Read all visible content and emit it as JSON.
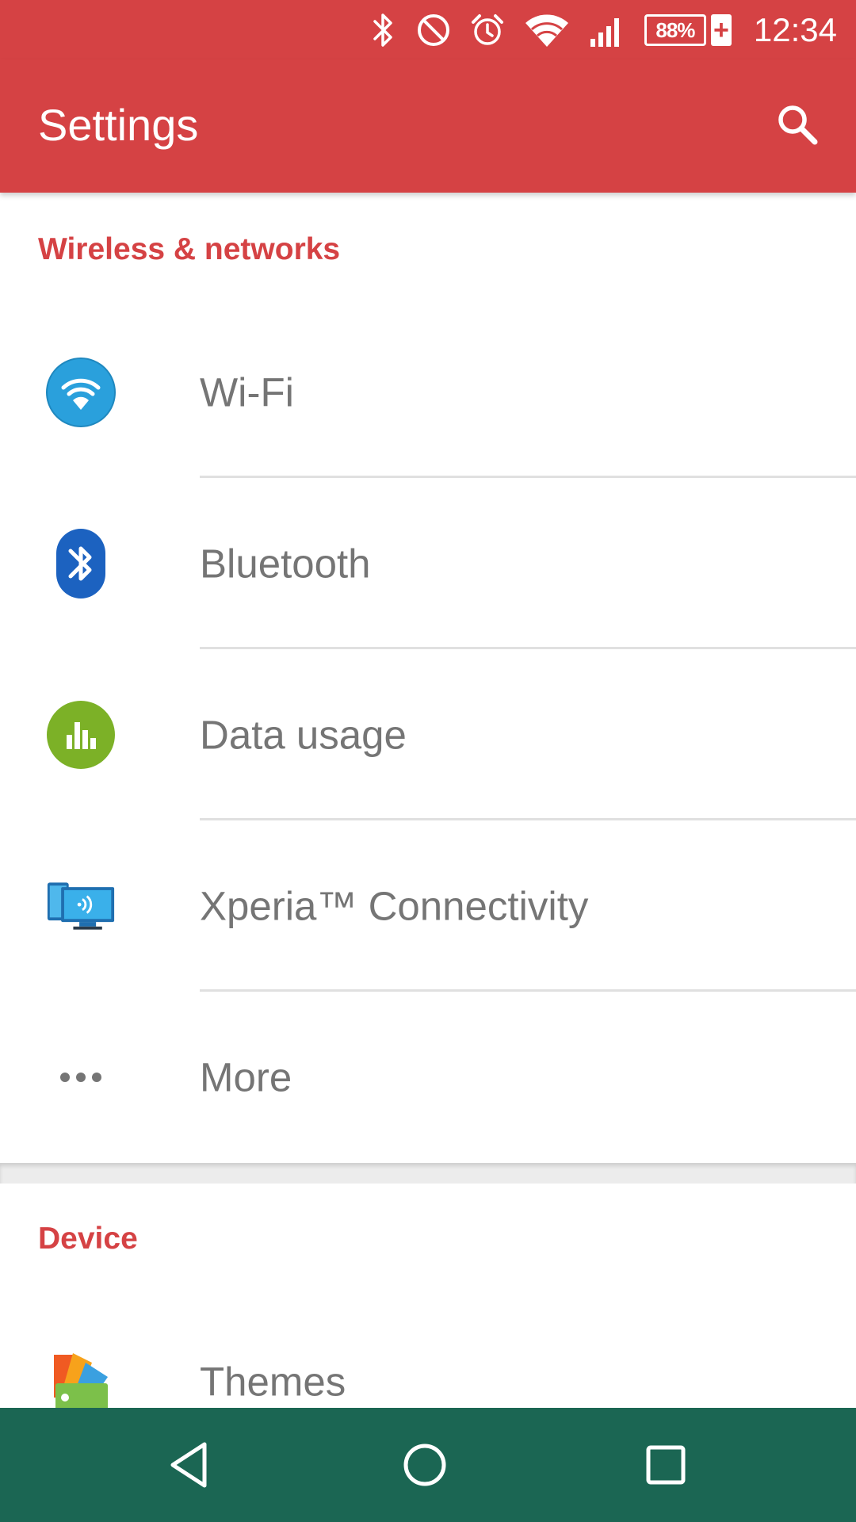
{
  "status_bar": {
    "battery_percent": "88%",
    "battery_charging_symbol": "+",
    "time": "12:34",
    "icons": [
      "bluetooth-icon",
      "do-not-disturb-icon",
      "alarm-icon",
      "wifi-signal-icon",
      "cell-signal-icon",
      "battery-icon"
    ],
    "background_color": "#d54244"
  },
  "app_bar": {
    "title": "Settings",
    "search_icon": "search-icon",
    "background_color": "#d54244"
  },
  "sections": [
    {
      "header": "Wireless & networks",
      "items": [
        {
          "label": "Wi-Fi",
          "icon": "wifi-icon"
        },
        {
          "label": "Bluetooth",
          "icon": "bluetooth-icon"
        },
        {
          "label": "Data usage",
          "icon": "data-usage-icon"
        },
        {
          "label": "Xperia™ Connectivity",
          "icon": "xperia-connectivity-icon"
        },
        {
          "label": "More",
          "icon": "more-icon"
        }
      ]
    },
    {
      "header": "Device",
      "items": [
        {
          "label": "Themes",
          "icon": "themes-icon"
        }
      ]
    }
  ],
  "nav_bar": {
    "buttons": [
      "back-icon",
      "home-icon",
      "recents-icon"
    ],
    "background_color": "#1b6653"
  },
  "colors": {
    "accent": "#d54244",
    "label_text": "#757575"
  }
}
